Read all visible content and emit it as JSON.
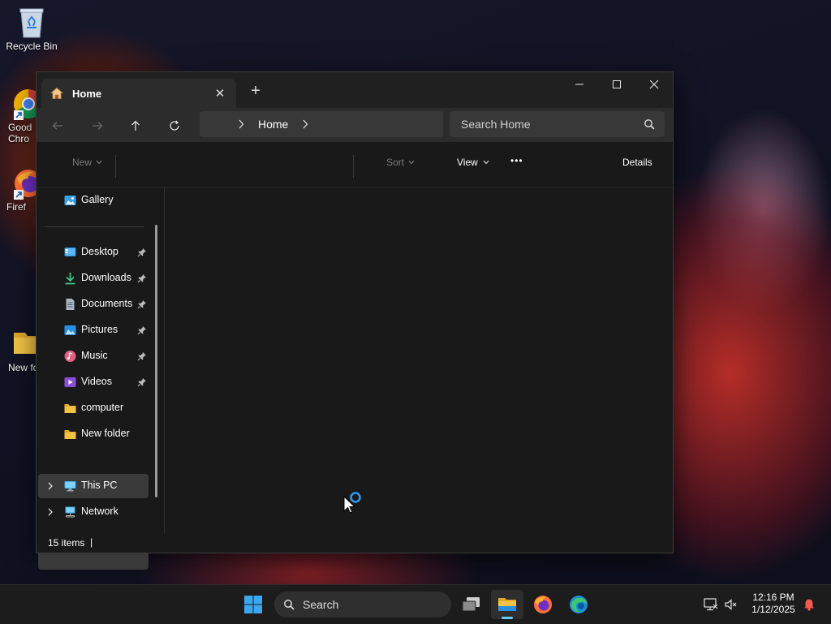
{
  "desktop": {
    "icons": [
      {
        "label": "Recycle Bin"
      },
      {
        "label": "Good\nChro"
      },
      {
        "label": "Firef"
      },
      {
        "label": "New fo"
      }
    ]
  },
  "window": {
    "tab": {
      "title": "Home",
      "close": "✕"
    },
    "new_tab": "+",
    "address": {
      "crumb": "Home"
    },
    "search": {
      "placeholder": "Search Home"
    },
    "toolbar": {
      "new_label": "New",
      "sort_label": "Sort",
      "view_label": "View",
      "more_label": "•••",
      "details_label": "Details"
    },
    "sidebar": {
      "items": [
        {
          "label": "Gallery"
        },
        {
          "label": "Desktop"
        },
        {
          "label": "Downloads"
        },
        {
          "label": "Documents"
        },
        {
          "label": "Pictures"
        },
        {
          "label": "Music"
        },
        {
          "label": "Videos"
        },
        {
          "label": "computer"
        },
        {
          "label": "New folder"
        },
        {
          "label": "This PC"
        },
        {
          "label": "Network"
        }
      ]
    },
    "status": {
      "items": "15 items",
      "divider": "|"
    }
  },
  "taskbar": {
    "search_label": "Search",
    "clock": {
      "time": "12:16 PM",
      "date": "1/12/2025"
    }
  },
  "colors": {
    "accent": "#0078d4",
    "folder": "#f3c443",
    "window_bg": "#191919",
    "navbar_bg": "#2c2c2c"
  }
}
